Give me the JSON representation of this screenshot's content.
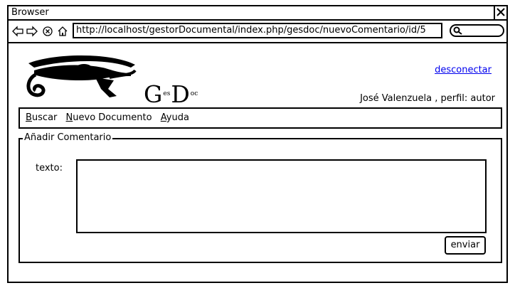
{
  "window": {
    "title": "Browser"
  },
  "browser": {
    "url": "http://localhost/gestorDocumental/index.php/gesdoc/nuevoComentario/id/5"
  },
  "header": {
    "logo_letters": {
      "g": "G",
      "es": "es",
      "d": "D",
      "oc": "oc"
    },
    "logout_label": "desconectar",
    "user_info": "José Valenzuela , perfil: autor"
  },
  "menu": {
    "items": [
      {
        "mnemonic": "B",
        "rest": "uscar"
      },
      {
        "mnemonic": "N",
        "rest": "uevo Documento"
      },
      {
        "mnemonic": "A",
        "rest": "yuda"
      }
    ]
  },
  "form": {
    "legend": "Añadir Comentario",
    "text_label": "texto:",
    "text_value": "",
    "submit_label": "enviar"
  }
}
